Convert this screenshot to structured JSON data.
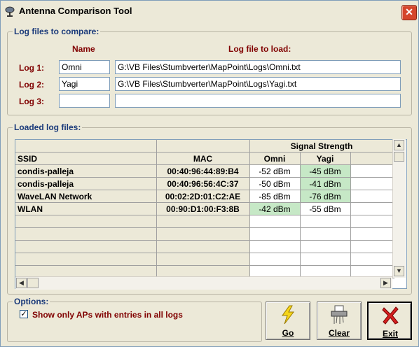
{
  "window": {
    "title": "Antenna Comparison Tool",
    "close_label": "✕",
    "icon": "antenna-icon"
  },
  "log_files": {
    "legend": "Log files to compare:",
    "name_header": "Name",
    "file_header": "Log file to load:",
    "rows": [
      {
        "label": "Log 1:",
        "name": "Omni",
        "file": "G:\\VB Files\\Stumbverter\\MapPoint\\Logs\\Omni.txt"
      },
      {
        "label": "Log 2:",
        "name": "Yagi",
        "file": "G:\\VB Files\\Stumbverter\\MapPoint\\Logs\\Yagi.txt"
      },
      {
        "label": "Log 3:",
        "name": "",
        "file": ""
      }
    ]
  },
  "loaded": {
    "legend": "Loaded log files:",
    "group_header": "Signal Strength",
    "columns": [
      "SSID",
      "MAC",
      "Omni",
      "Yagi"
    ],
    "rows": [
      {
        "ssid": "condis-palleja",
        "mac": "00:40:96:44:89:B4",
        "omni": "-52 dBm",
        "yagi": "-45 dBm",
        "best": "yagi"
      },
      {
        "ssid": "condis-palleja",
        "mac": "00:40:96:56:4C:37",
        "omni": "-50 dBm",
        "yagi": "-41 dBm",
        "best": "yagi"
      },
      {
        "ssid": "WaveLAN Network",
        "mac": "00:02:2D:01:C2:AE",
        "omni": "-85 dBm",
        "yagi": "-76 dBm",
        "best": "yagi"
      },
      {
        "ssid": "WLAN",
        "mac": "00:90:D1:00:F3:8B",
        "omni": "-42 dBm",
        "yagi": "-55 dBm",
        "best": "omni"
      }
    ],
    "highlight_color": "#c6e8c6"
  },
  "options": {
    "legend": "Options:",
    "show_all_label": "Show only APs with entries in all logs",
    "show_all_checked": "✓"
  },
  "buttons": {
    "go": {
      "label": "Go",
      "icon": "lightning-icon"
    },
    "clear": {
      "label": "Clear",
      "icon": "shredder-icon"
    },
    "exit": {
      "label": "Exit",
      "icon": "red-x-icon"
    }
  },
  "colors": {
    "label": "#800000",
    "legend": "#1a3a7a",
    "window_bg": "#ece9d8"
  }
}
